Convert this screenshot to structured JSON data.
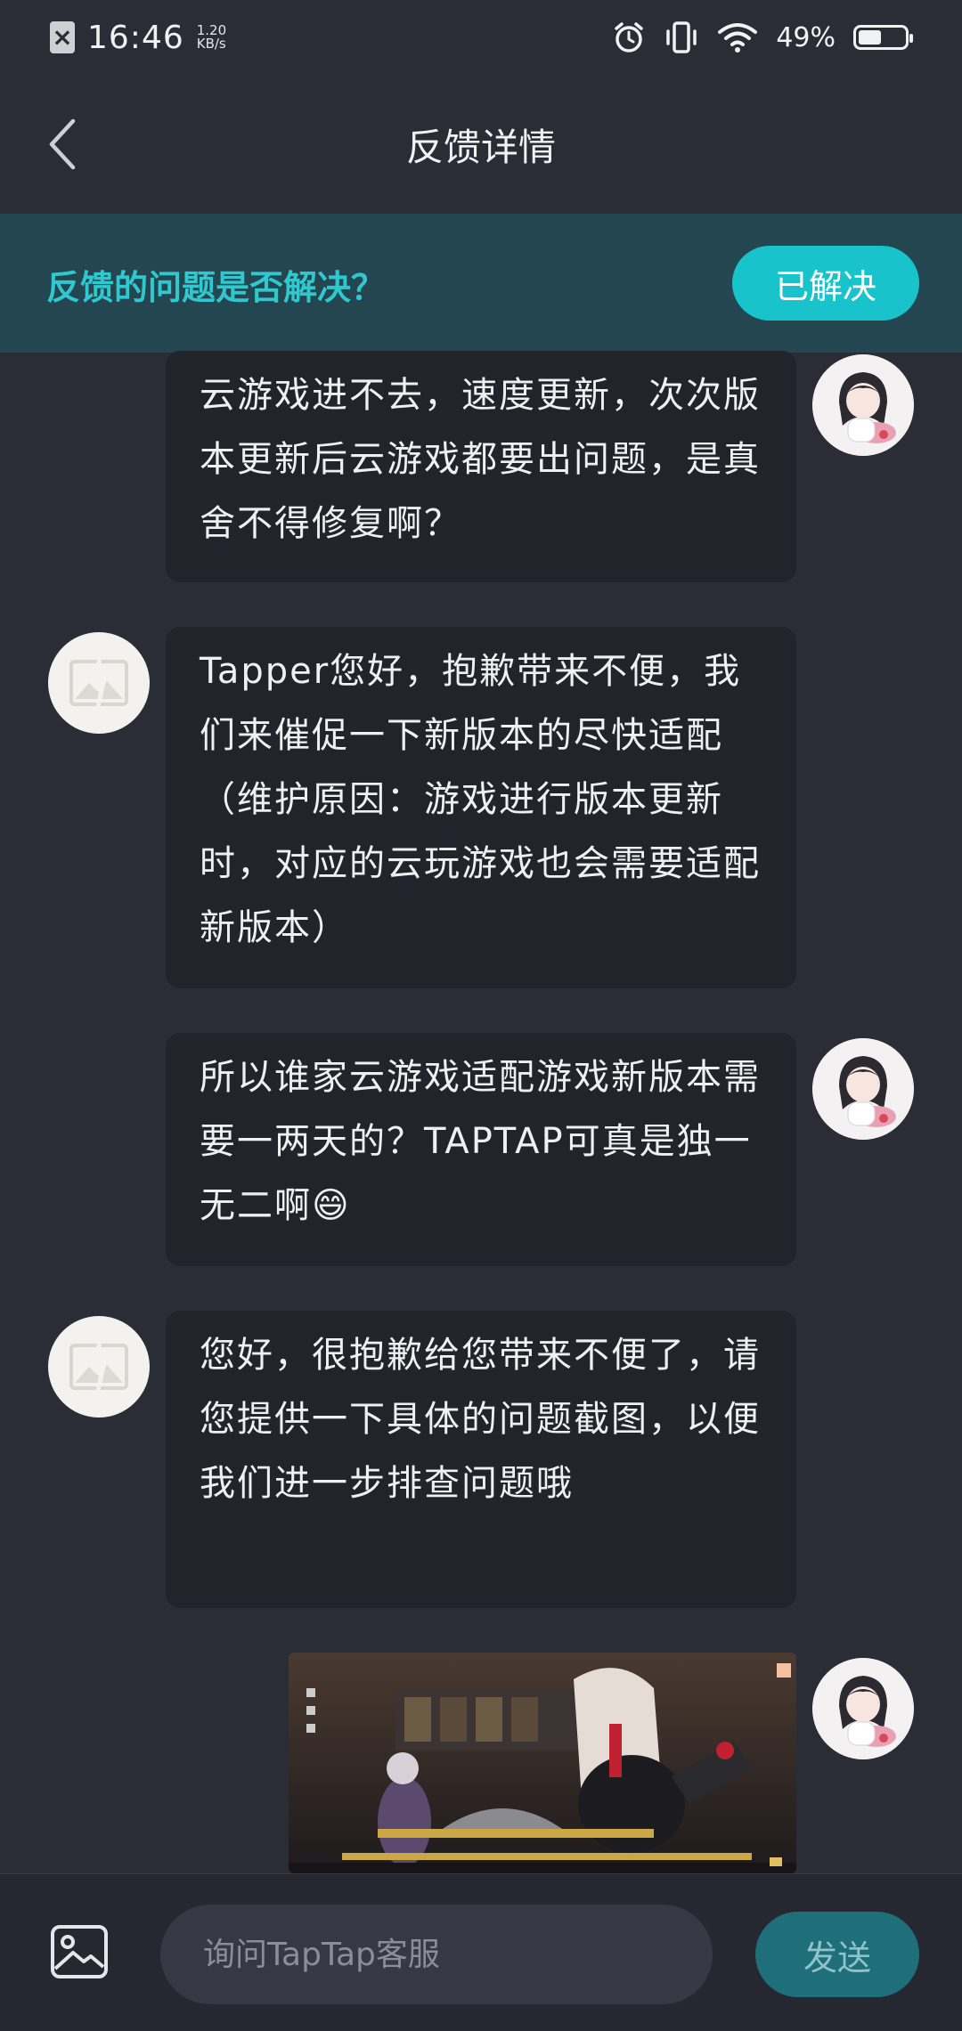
{
  "status_bar": {
    "time": "16:46",
    "net_speed_value": "1.20",
    "net_speed_unit": "KB/s",
    "battery_percent": "49%",
    "battery_level": 0.49
  },
  "header": {
    "title": "反馈详情"
  },
  "banner": {
    "question": "反馈的问题是否解决？",
    "resolved_label": "已解决"
  },
  "messages": [
    {
      "sender": "user",
      "text": "云游戏进不去，速度更新，次次版本更新后云游戏都要出问题，是真舍不得修复啊？"
    },
    {
      "sender": "support",
      "text": "Tapper您好，抱歉带来不便，我们来催促一下新版本的尽快适配（维护原因：游戏进行版本更新时，对应的云玩游戏也会需要适配新版本）"
    },
    {
      "sender": "user",
      "text": "所以谁家云游戏适配游戏新版本需要一两天的？TAPTAP可真是独一无二啊😄"
    },
    {
      "sender": "support",
      "text": "您好，很抱歉给您带来不便了，请您提供一下具体的问题截图，以便我们进一步排查问题哦"
    },
    {
      "sender": "user",
      "type": "image"
    }
  ],
  "input_bar": {
    "placeholder": "询问TapTap客服",
    "send_label": "发送"
  },
  "colors": {
    "background": "#2b2d36",
    "accent": "#18c3cc",
    "banner": "#234650",
    "bubble": "#22232b"
  }
}
